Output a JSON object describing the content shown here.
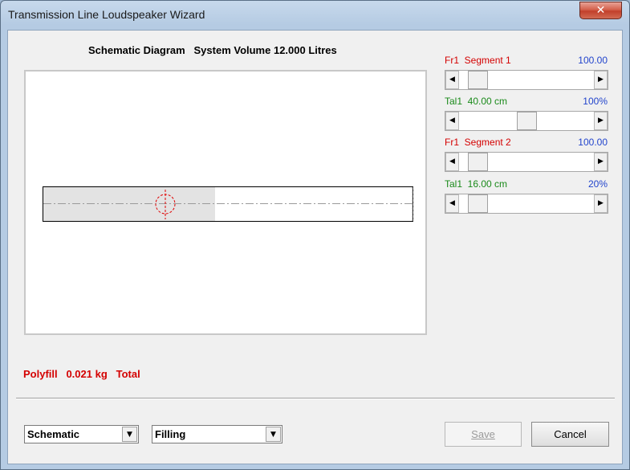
{
  "window": {
    "title": "Transmission Line Loudspeaker Wizard",
    "close_glyph": "✕"
  },
  "diagram": {
    "title": "Schematic Diagram   System Volume 12.000 Litres"
  },
  "sliders": [
    {
      "label": "Fr1  Segment 1",
      "value": "100.00",
      "label_color": "#d40000",
      "position": 0.08
    },
    {
      "label": "Tal1  40.00 cm",
      "value": "100%",
      "label_color": "#1a8a1a",
      "position": 0.5
    },
    {
      "label": "Fr1  Segment 2",
      "value": "100.00",
      "label_color": "#d40000",
      "position": 0.08
    },
    {
      "label": "Tal1  16.00 cm",
      "value": "20%",
      "label_color": "#1a8a1a",
      "position": 0.08
    }
  ],
  "status": {
    "polyfill": "Polyfill   0.021 kg   Total"
  },
  "controls": {
    "view_select": "Schematic",
    "mode_select": "Filling",
    "save_label": "Save",
    "cancel_label": "Cancel"
  },
  "icons": {
    "arrow_left": "◀",
    "arrow_right": "▶",
    "dropdown": "▼"
  }
}
